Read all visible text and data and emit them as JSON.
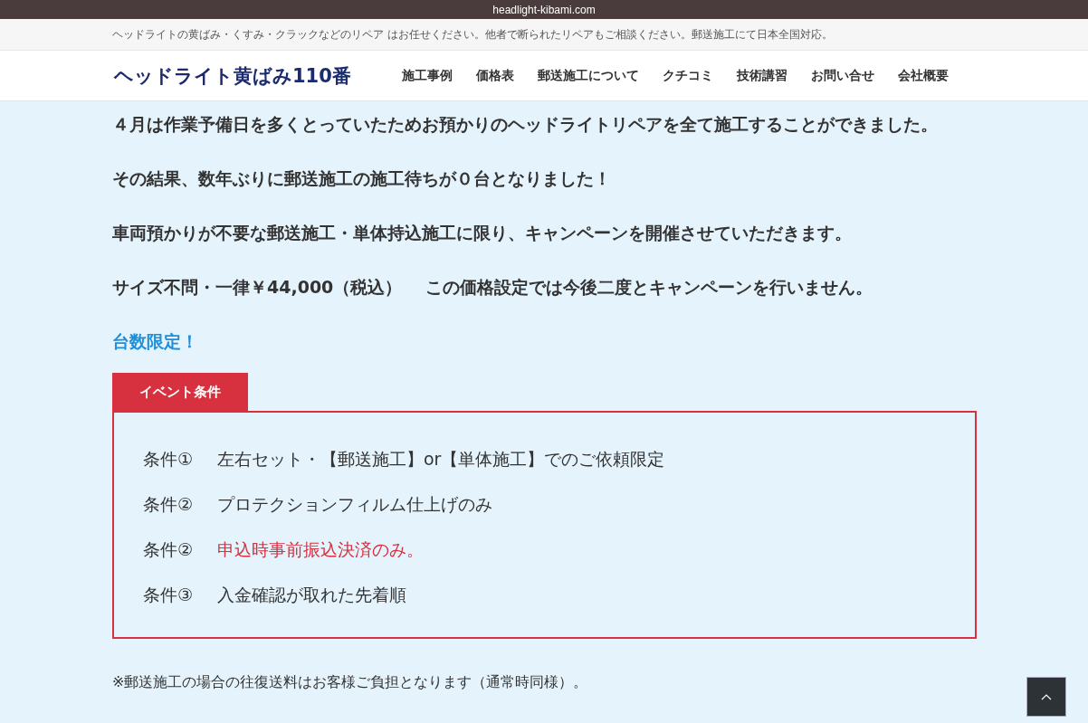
{
  "browser_bar": {
    "url": "headlight-kibami.com"
  },
  "tagline": "ヘッドライトの黄ばみ・くすみ・クラックなどのリペア はお任せください。他者で断られたリペアもご相談ください。郵送施工にて日本全国対応。",
  "header": {
    "logo": "ヘッドライト黄ばみ110番",
    "nav": [
      "施工事例",
      "価格表",
      "郵送施工について",
      "クチコミ",
      "技術講習",
      "お問い合せ",
      "会社概要"
    ]
  },
  "paragraphs": [
    {
      "text": "４月は作業予備日を多くとっていたためお預かりのヘッドライトリペアを全て施工することができました。",
      "kind": "normal"
    },
    {
      "text": "その結果、数年ぶりに郵送施工の施工待ちが０台となりました！",
      "kind": "normal"
    },
    {
      "text": "車両預かりが不要な郵送施工・単体持込施工に限り、キャンペーンを開催させていただきます。",
      "kind": "normal"
    },
    {
      "text": "サイズ不問・一律￥44,000（税込）　 この価格設定では今後二度とキャンペーンを行いません。",
      "kind": "normal"
    },
    {
      "text": "台数限定！",
      "kind": "accent"
    }
  ],
  "event": {
    "tab": "イベント条件",
    "conditions": [
      {
        "label": "条件①",
        "text": "左右セット・【郵送施工】or【単体施工】でのご依頼限定",
        "kind": "normal"
      },
      {
        "label": "条件②",
        "text": "プロテクションフィルム仕上げのみ",
        "kind": "normal"
      },
      {
        "label": "条件②",
        "text": "申込時事前振込決済のみ。",
        "kind": "emphasis"
      },
      {
        "label": "条件③",
        "text": "入金確認が取れた先着順",
        "kind": "normal"
      }
    ]
  },
  "note": "※郵送施工の場合の往復送料はお客様ご負担となります（通常時同様）。"
}
